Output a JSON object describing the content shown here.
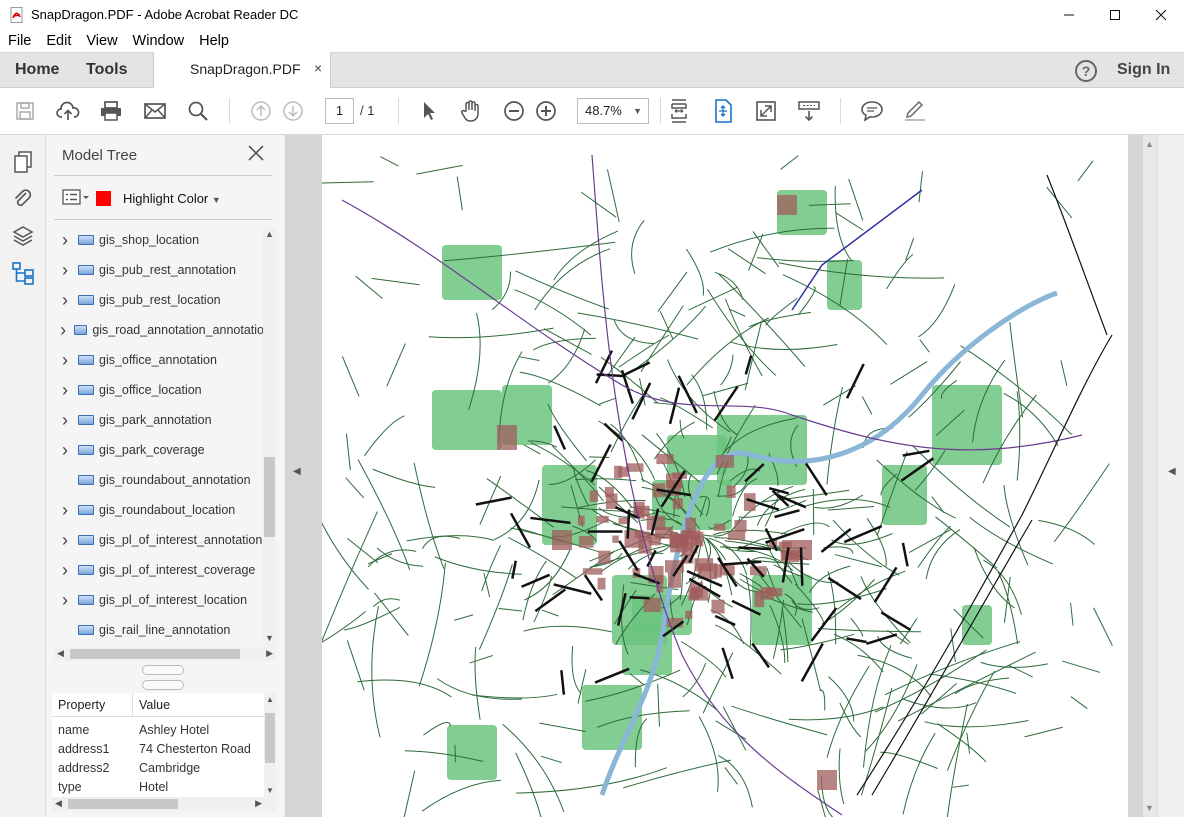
{
  "window": {
    "title": "SnapDragon.PDF - Adobe Acrobat Reader DC",
    "minimize": "—",
    "maximize": "☐",
    "close": "✕"
  },
  "menu": [
    "File",
    "Edit",
    "View",
    "Window",
    "Help"
  ],
  "tabs": {
    "home": "Home",
    "tools": "Tools",
    "document": "SnapDragon.PDF",
    "document_close": "×",
    "help": "?",
    "signin": "Sign In"
  },
  "toolbar": {
    "page_current": "1",
    "page_total": "/ 1",
    "zoom": "48.7%"
  },
  "model_tree": {
    "title": "Model Tree",
    "highlight_label": "Highlight Color",
    "highlight_color": "#ff0000",
    "items": [
      {
        "label": "gis_shop_location",
        "expandable": true
      },
      {
        "label": "gis_pub_rest_annotation",
        "expandable": true
      },
      {
        "label": "gis_pub_rest_location",
        "expandable": true
      },
      {
        "label": "gis_road_annotation_annotatio",
        "expandable": true
      },
      {
        "label": "gis_office_annotation",
        "expandable": true
      },
      {
        "label": "gis_office_location",
        "expandable": true
      },
      {
        "label": "gis_park_annotation",
        "expandable": true
      },
      {
        "label": "gis_park_coverage",
        "expandable": true
      },
      {
        "label": "gis_roundabout_annotation",
        "expandable": false
      },
      {
        "label": "gis_roundabout_location",
        "expandable": true
      },
      {
        "label": "gis_pl_of_interest_annotation",
        "expandable": true
      },
      {
        "label": "gis_pl_of_interest_coverage",
        "expandable": true
      },
      {
        "label": "gis_pl_of_interest_location",
        "expandable": true
      },
      {
        "label": "gis_rail_line_annotation",
        "expandable": false
      }
    ]
  },
  "properties": {
    "col_property": "Property",
    "col_value": "Value",
    "rows": [
      {
        "property": "name",
        "value": "Ashley Hotel"
      },
      {
        "property": "address1",
        "value": "74 Chesterton Road"
      },
      {
        "property": "address2",
        "value": "Cambridge"
      },
      {
        "property": "type",
        "value": "Hotel"
      }
    ]
  },
  "map": {
    "road_color": "#2e6b3a",
    "park_color": "#6cc47e",
    "building_color": "#a05c5c",
    "river_color": "#8ab6d8",
    "rail_color": "#111111",
    "boundary_color": "#6a3d8f"
  }
}
